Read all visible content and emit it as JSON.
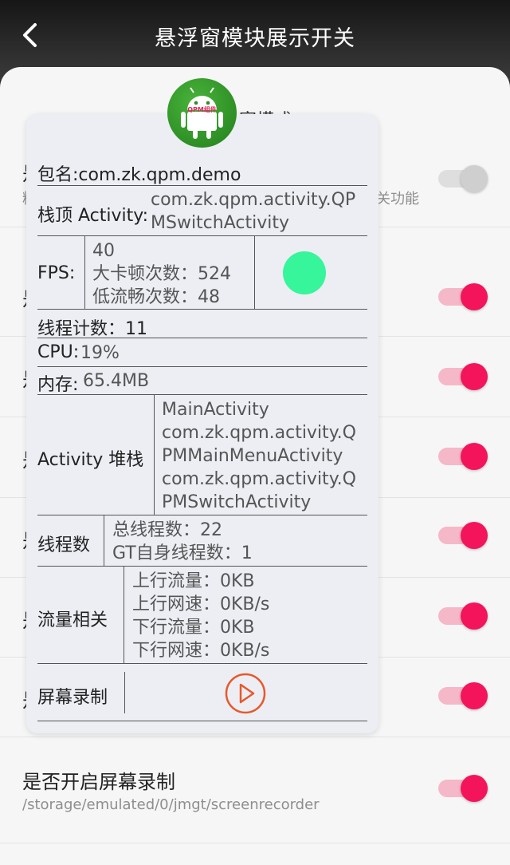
{
  "header": {
    "title": "悬浮窗模块展示开关",
    "back_icon": "chevron-left-icon"
  },
  "behind_text": "窗模式",
  "rows": [
    {
      "title_fragment": "是",
      "sub_fragment": "精",
      "sub_right": "关功能",
      "toggle_on": false
    },
    {
      "title_fragment": "是",
      "toggle_on": true
    },
    {
      "title_fragment": "是",
      "toggle_on": true
    },
    {
      "title_fragment": "是",
      "toggle_on": true
    },
    {
      "title_fragment": "是",
      "toggle_on": true
    },
    {
      "title_fragment": "是",
      "toggle_on": true
    },
    {
      "title_fragment": "是",
      "toggle_on": true
    }
  ],
  "last_row": {
    "title": "是否开启屏幕录制",
    "subtitle": "/storage/emulated/0/jmgt/screenrecorder",
    "toggle_on": true
  },
  "float": {
    "logo_text": "QPM组件",
    "package": "包名:com.zk.qpm.demo",
    "top_activity_label": "栈顶 Activity:",
    "top_activity_value_1": "com.zk.qpm.activity.QP",
    "top_activity_value_2": "MSwitchActivity",
    "fps_label": "FPS:",
    "fps_value": "40",
    "fps_big_jank": "大卡顿次数：524",
    "fps_low_smooth": "低流畅次数：48",
    "thread_count": "线程计数：11",
    "cpu_label": "CPU:",
    "cpu_value": "19%",
    "mem_label": "内存:",
    "mem_value": "65.4MB",
    "activity_stack_label": "Activity 堆栈",
    "activity_stack_lines": [
      "MainActivity",
      "com.zk.qpm.activity.Q",
      "PMMainMenuActivity",
      "com.zk.qpm.activity.Q",
      "PMSwitchActivity"
    ],
    "threads_label": "线程数",
    "threads_total": "总线程数：22",
    "threads_gt": "GT自身线程数：1",
    "traffic_label": "流量相关",
    "traffic_lines": [
      "上行流量：0KB",
      "上行网速：0KB/s",
      "下行流量：0KB",
      "下行网速：0KB/s"
    ],
    "screen_rec_label": "屏幕录制",
    "play_icon": "play-circle-icon"
  },
  "colors": {
    "accent": "#f4145c",
    "toggle_track_on": "#f5b8c8",
    "fps_indicator": "#36f59a",
    "play_icon": "#e8582a",
    "logo_green": "#2e8f25"
  }
}
